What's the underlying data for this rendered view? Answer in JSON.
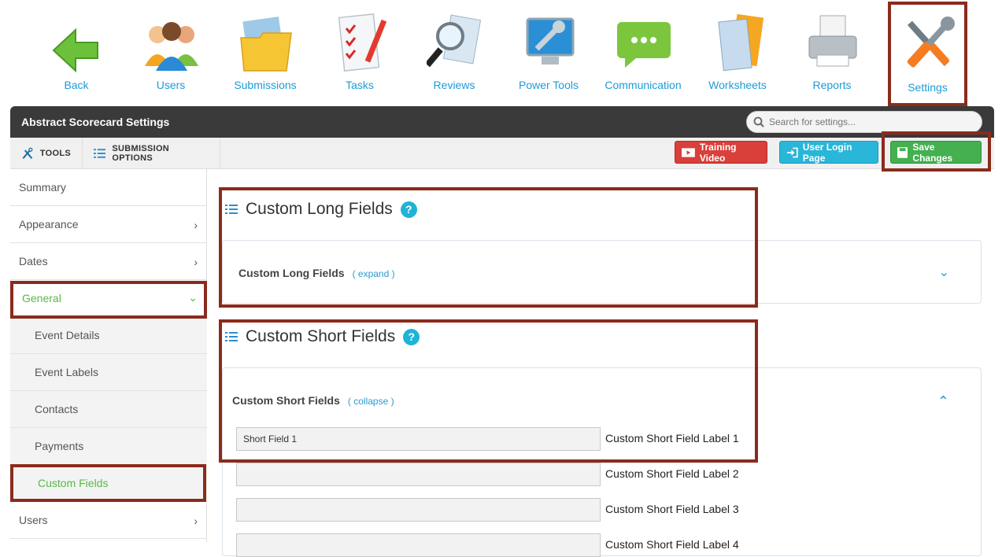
{
  "nav": [
    {
      "label": "Back",
      "icon": "back-arrow-icon"
    },
    {
      "label": "Users",
      "icon": "users-icon"
    },
    {
      "label": "Submissions",
      "icon": "folder-icon"
    },
    {
      "label": "Tasks",
      "icon": "checklist-icon"
    },
    {
      "label": "Reviews",
      "icon": "magnifier-icon"
    },
    {
      "label": "Power Tools",
      "icon": "monitor-wrench-icon"
    },
    {
      "label": "Communication",
      "icon": "chat-bubble-icon"
    },
    {
      "label": "Worksheets",
      "icon": "worksheets-icon"
    },
    {
      "label": "Reports",
      "icon": "printer-icon"
    },
    {
      "label": "Settings",
      "icon": "tools-icon"
    }
  ],
  "header": {
    "title": "Abstract Scorecard Settings",
    "search_placeholder": "Search for settings..."
  },
  "toolbar": {
    "tools_label": "TOOLS",
    "submission_options_label": "SUBMISSION OPTIONS",
    "training_video": "Training Video",
    "user_login_page": "User Login Page",
    "save_changes": "Save Changes"
  },
  "sidebar": {
    "items": [
      {
        "label": "Summary"
      },
      {
        "label": "Appearance"
      },
      {
        "label": "Dates"
      },
      {
        "label": "General"
      },
      {
        "label": "Event Details"
      },
      {
        "label": "Event Labels"
      },
      {
        "label": "Contacts"
      },
      {
        "label": "Payments"
      },
      {
        "label": "Custom Fields"
      },
      {
        "label": "Users"
      }
    ]
  },
  "main": {
    "long_section_title": "Custom Long Fields",
    "long_panel_title": "Custom Long Fields",
    "long_panel_link": "( expand )",
    "short_section_title": "Custom Short Fields",
    "short_panel_title": "Custom Short Fields",
    "short_panel_link": "( collapse )",
    "help_glyph": "?",
    "fields": [
      {
        "value": "Short Field 1",
        "label": "Custom Short Field Label 1"
      },
      {
        "value": "",
        "label": "Custom Short Field Label 2"
      },
      {
        "value": "",
        "label": "Custom Short Field Label 3"
      },
      {
        "value": "",
        "label": "Custom Short Field Label 4"
      }
    ]
  },
  "colors": {
    "accent": "#1e9bd7",
    "highlight": "#8b2b1c",
    "green": "#58b947"
  }
}
